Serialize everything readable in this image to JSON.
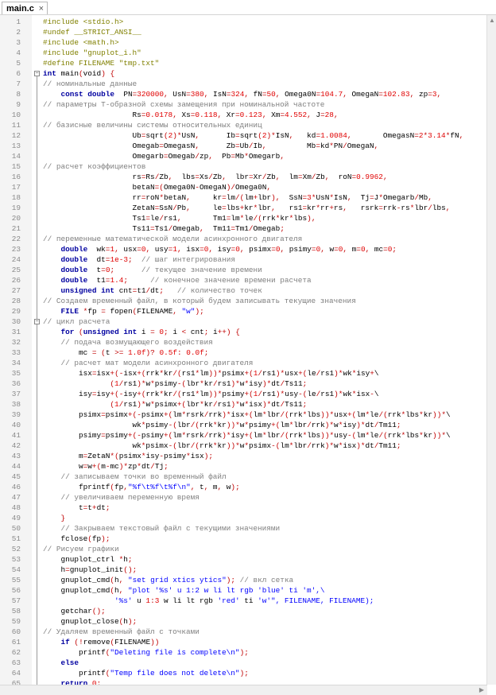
{
  "tab": {
    "label": "main.c",
    "close": "×"
  },
  "lines": [
    "#include <stdio.h>",
    "#undef __STRICT_ANSI__",
    "#include <math.h>",
    "#include \"gnuplot_i.h\"",
    "#define FILENAME \"tmp.txt\"",
    "int main(void) {",
    "// номинальные данные",
    "    const double  PN=320000, UsN=380, IsN=324, fN=50, Omega0N=104.7, OmegaN=102.83, zp=3,",
    "// параметры Т-образной схемы замещения при номинальной частоте",
    "                    Rs=0.0178, Xs=0.118, Xr=0.123, Xm=4.552, J=28,",
    "// базисные величины системы относительных единиц",
    "                    Ub=sqrt(2)*UsN,      Ib=sqrt(2)*IsN,   kd=1.0084,       OmegasN=2*3.14*fN,",
    "                    Omegab=OmegasN,      Zb=Ub/Ib,         Mb=kd*PN/OmegaN,",
    "                    Omegarb=Omegab/zp,  Pb=Mb*Omegarb,",
    "// расчет коэффициентов",
    "                    rs=Rs/Zb,  lbs=Xs/Zb,  lbr=Xr/Zb,  lm=Xm/Zb,  roN=0.9962,",
    "                    betaN=(Omega0N-OmegaN)/Omega0N,",
    "                    rr=roN*betaN,     kr=lm/(lm+lbr),  SsN=3*UsN*IsN,  Tj=J*Omegarb/Mb,",
    "                    ZetaN=SsN/Pb,     le=lbs+kr*lbr,   rs1=kr*rr+rs,   rsrk=rrk-rs*lbr/lbs,",
    "                    Ts1=le/rs1,       Tm1=lm*le/(rrk*kr*lbs),",
    "                    Ts11=Ts1/Omegab,  Tm11=Tm1/Omegab;",
    "// переменные математической модели асинхронного двигателя",
    "    double  wk=1, usx=0, usy=1, isx=0, isy=0, psimx=0, psimy=0, w=0, m=0, mc=0;",
    "    double  dt=1e-3;  // шаг интегрирования",
    "    double  t=0;      // текущее значение времени",
    "    double  t1=1.4;     // конечное значение времени расчета",
    "    unsigned int cnt=t1/dt;   // количество точек",
    "// Создаем временный файл, в который будем записывать текущие значения",
    "    FILE *fp = fopen(FILENAME, \"w\");",
    "// цикл расчета",
    "    for (unsigned int i = 0; i < cnt; i++) {",
    "    // подача возмущающего воздействия",
    "        mc = (t >= 1.0f)? 0.5f: 0.0f;",
    "    // расчет мат модели асинхронного двигателя",
    "        isx=isx+(-isx+(rrk*kr/(rs1*lm))*psimx+(1/rs1)*usx+(le/rs1)*wk*isy+\\",
    "               (1/rs1)*w*psimy-(lbr*kr/rs1)*w*isy)*dt/Ts11;",
    "        isy=isy+(-isy+(rrk*kr/(rs1*lm))*psimy+(1/rs1)*usy-(le/rs1)*wk*isx-\\",
    "               (1/rs1)*w*psimx+(lbr*kr/rs1)*w*isx)*dt/Ts11;",
    "        psimx=psimx+(-psimx+(lm*rsrk/rrk)*isx+(lm*lbr/(rrk*lbs))*usx+(lm*le/(rrk*lbs*kr))*\\",
    "                    wk*psimy-(lbr/(rrk*kr))*w*psimy+(lm*lbr/rrk)*w*isy)*dt/Tm11;",
    "        psimy=psimy+(-psimy+(lm*rsrk/rrk)*isy+(lm*lbr/(rrk*lbs))*usy-(lm*le/(rrk*lbs*kr))*\\",
    "                    wk*psimx-(lbr/(rrk*kr))*w*psimx-(lm*lbr/rrk)*w*isx)*dt/Tm11;",
    "        m=ZetaN*(psimx*isy-psimy*isx);",
    "        w=w+(m-mc)*zp*dt/Tj;",
    "    // записываем точки во временный файл",
    "        fprintf(fp,\"%f\\t%f\\t%f\\n\", t, m, w);",
    "    // увеличиваем переменную время",
    "        t=t+dt;",
    "    }",
    "    // Закрываем текстовый файл с текущими значениями",
    "    fclose(fp);",
    "// Рисуем графики",
    "    gnuplot_ctrl *h;",
    "    h=gnuplot_init();",
    "    gnuplot_cmd(h, \"set grid xtics ytics\"); // вкл сетка",
    "    gnuplot_cmd(h, \"plot '%s' u 1:2 w li lt rgb 'blue' ti 'm',\\",
    "                '%s' u 1:3 w li lt rgb 'red' ti 'w'\", FILENAME, FILENAME);",
    "    getchar();",
    "    gnuplot_close(h);",
    "// Удаляем временный файл с точками",
    "    if (!remove(FILENAME))",
    "        printf(\"Deleting file is complete\\n\");",
    "    else",
    "        printf(\"Temp file does not delete\\n\");",
    "    return 0;",
    "}"
  ]
}
